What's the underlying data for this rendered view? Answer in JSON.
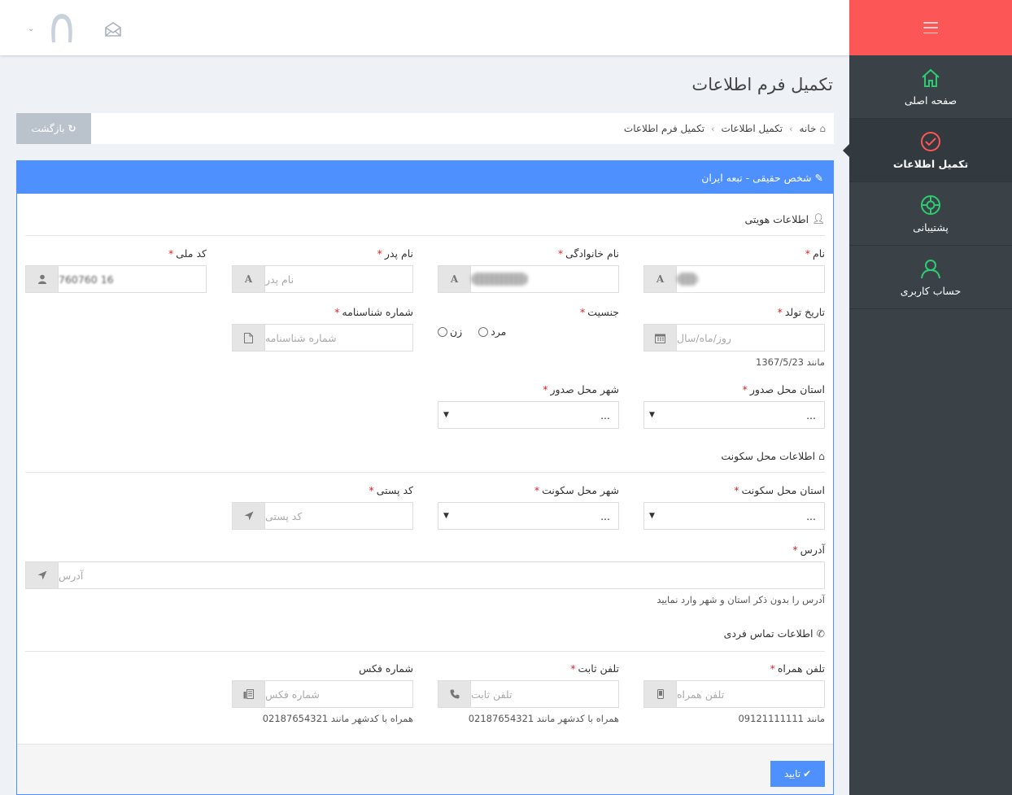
{
  "sidebar": {
    "items": [
      {
        "label": "صفحه اصلی",
        "icon": "home-icon",
        "color": "#2ecc71"
      },
      {
        "label": "تکمیل اطلاعات",
        "icon": "check-circle-icon",
        "color": "#fd5657",
        "active": true
      },
      {
        "label": "پشتیبانی",
        "icon": "lifebuoy-icon",
        "color": "#2ecc71"
      },
      {
        "label": "حساب کاربری",
        "icon": "user-icon",
        "color": "#2ecc71"
      }
    ]
  },
  "header": {
    "user_icon": "avatar-icon",
    "mail_icon": "mail-icon"
  },
  "page": {
    "title": "تکمیل فرم اطلاعات",
    "back_label": "بازگشت",
    "breadcrumb": [
      "خانه",
      "تکمیل اطلاعات",
      "تکمیل فرم اطلاعات"
    ]
  },
  "panel": {
    "title": "شخص حقیقی - تبعه ایران",
    "sections": {
      "identity": "اطلاعات هویتی",
      "residence": "اطلاعات محل سکونت",
      "contact": "اطلاعات تماس فردی"
    },
    "fields": {
      "first_name": {
        "label": "نام",
        "value": ""
      },
      "last_name": {
        "label": "نام خانوادگی",
        "value": ""
      },
      "father_name": {
        "label": "نام پدر",
        "placeholder": "نام پدر"
      },
      "national_code": {
        "label": "کد ملی",
        "value": "16 760760"
      },
      "birth_date": {
        "label": "تاریخ تولد",
        "placeholder": "روز/ماه/سال",
        "help": "مانند 1367/5/23"
      },
      "gender": {
        "label": "جنسیت",
        "options": [
          "مرد",
          "زن"
        ]
      },
      "id_number": {
        "label": "شماره شناسنامه",
        "placeholder": "شماره شناسنامه"
      },
      "issue_province": {
        "label": "استان محل صدور",
        "value": "..."
      },
      "issue_city": {
        "label": "شهر محل صدور",
        "value": "..."
      },
      "res_province": {
        "label": "استان محل سکونت",
        "value": "..."
      },
      "res_city": {
        "label": "شهر محل سکونت",
        "value": "..."
      },
      "postal_code": {
        "label": "کد پستی",
        "placeholder": "کد پستی"
      },
      "address": {
        "label": "آدرس",
        "placeholder": "آدرس",
        "help": "آدرس را بدون ذکر استان و شهر وارد نمایید"
      },
      "mobile": {
        "label": "تلفن همراه",
        "placeholder": "تلفن همراه",
        "help": "مانند 09121111111"
      },
      "phone": {
        "label": "تلفن ثابت",
        "placeholder": "تلفن ثابت",
        "help": "همراه با کدشهر مانند 02187654321"
      },
      "fax": {
        "label": "شماره فکس",
        "placeholder": "شماره فکس",
        "help": "همراه با کدشهر مانند 02187654321"
      }
    },
    "confirm_label": "تایید"
  }
}
